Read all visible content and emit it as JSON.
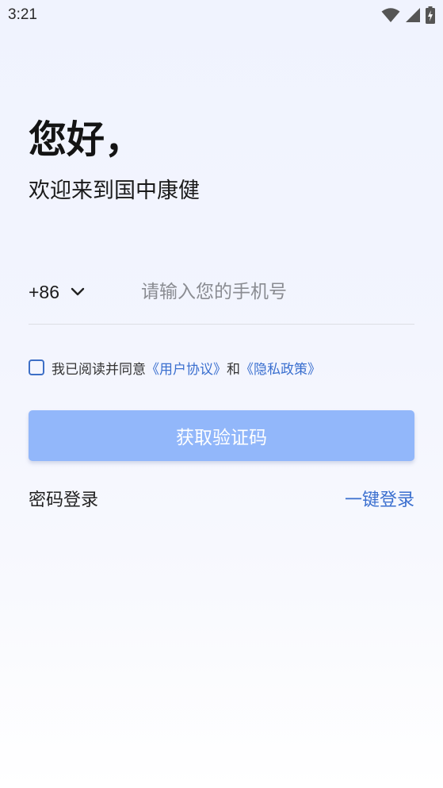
{
  "status_bar": {
    "time": "3:21"
  },
  "header": {
    "greeting": "您好，",
    "welcome": "欢迎来到国中康健"
  },
  "phone": {
    "country_code": "+86",
    "placeholder": "请输入您的手机号",
    "value": ""
  },
  "agreement": {
    "checked": false,
    "prefix": "我已阅读并同意",
    "user_agreement": "《用户协议》",
    "conjunction": "和",
    "privacy_policy": "《隐私政策》"
  },
  "actions": {
    "get_code": "获取验证码",
    "password_login": "密码登录",
    "onekey_login": "一键登录"
  },
  "colors": {
    "accent": "#3a6fcf",
    "button_disabled": "#92b7fa"
  },
  "icons": {
    "wifi": "wifi-icon",
    "signal": "signal-icon",
    "battery": "battery-charging-icon",
    "dropdown": "chevron-down-icon"
  }
}
